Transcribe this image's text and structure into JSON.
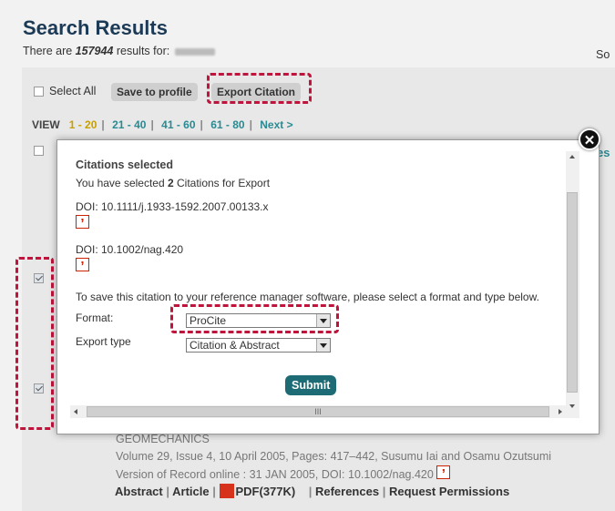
{
  "header": {
    "title": "Search Results",
    "count_prefix": "There are ",
    "count": "157944",
    "count_suffix": " results for: ",
    "sort_label": "So"
  },
  "toolbar": {
    "select_all": "Select All",
    "save_to_profile": "Save to profile",
    "export_citation": "Export Citation"
  },
  "pagination": {
    "view_label": "VIEW",
    "current": "1 - 20",
    "pages": [
      "21 - 40",
      "41 - 60",
      "61 - 80"
    ],
    "next": "Next >"
  },
  "modal": {
    "section_title": "Citations selected",
    "selected_prefix": "You have selected ",
    "selected_count": "2",
    "selected_suffix": " Citations for Export",
    "dois": [
      "DOI: 10.1111/j.1933-1592.2007.00133.x",
      "DOI: 10.1002/nag.420"
    ],
    "instruction": "To save this citation to your reference manager software, please select a format and type below.",
    "format_label": "Format:",
    "format_value": "ProCite",
    "export_type_label": "Export type",
    "export_type_value": "Citation & Abstract",
    "submit": "Submit",
    "close_glyph": "✕",
    "hscroll_grip": "III",
    "side_peek": "es"
  },
  "background_result": {
    "journal": "GEOMECHANICS",
    "meta": "Volume 29, Issue 4, 10 April 2005, Pages: 417–442, Susumu Iai and Osamu Ozutsumi",
    "version": "Version of Record online : 31 JAN 2005, DOI: 10.1002/nag.420",
    "links": {
      "abstract": "Abstract",
      "article": "Article",
      "pdf": "PDF(377K)",
      "references": "References",
      "request_permissions": "Request Permissions"
    }
  },
  "icons": {
    "citation": "citation-quote-icon",
    "pdf": "pdf-icon",
    "close": "close-icon"
  },
  "colors": {
    "highlight": "#c0143c",
    "submit": "#1d6b74",
    "link": "#2a8a92",
    "current_page": "#c8a000"
  }
}
